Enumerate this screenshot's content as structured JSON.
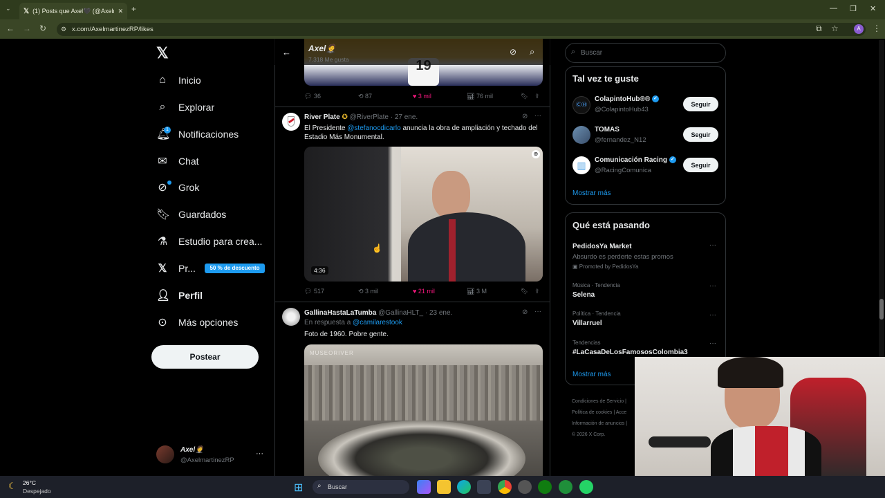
{
  "browser": {
    "tab_title": "(1) Posts que Axel🖤 (@Axelm",
    "url": "x.com/AxelmartinezRP/likes"
  },
  "nav": {
    "items": [
      {
        "label": "Inicio",
        "icon": "home-icon"
      },
      {
        "label": "Explorar",
        "icon": "search-icon"
      },
      {
        "label": "Notificaciones",
        "icon": "bell-icon"
      },
      {
        "label": "Chat",
        "icon": "mail-icon"
      },
      {
        "label": "Grok",
        "icon": "grok-icon"
      },
      {
        "label": "Guardados",
        "icon": "bookmark-icon"
      },
      {
        "label": "Estudio para crea...",
        "icon": "flask-icon"
      },
      {
        "label": "Pr...",
        "icon": "x-logo-icon"
      },
      {
        "label": "Perfil",
        "icon": "person-icon"
      },
      {
        "label": "Más opciones",
        "icon": "more-circle-icon"
      }
    ],
    "notif_count": "1",
    "premium_badge": "50 % de descuento",
    "post_button": "Postear",
    "account_name": "Axel🤵",
    "account_handle": "@AxelmartinezRP"
  },
  "header": {
    "name": "Axel🤵",
    "likes": "7.318 Me gusta"
  },
  "post0": {
    "replies": "36",
    "reposts": "87",
    "likes": "3 mil",
    "views": "76 mil"
  },
  "post1": {
    "name": "River Plate",
    "handle": "@RiverPlate",
    "date": "· 27 ene.",
    "text_a": "El Presidente ",
    "mention": "@stefanocdicarlo",
    "text_b": " anuncia la obra de ampliación y techado del Estadio Más Monumental.",
    "duration": "4:36",
    "replies": "517",
    "reposts": "3 mil",
    "likes": "21 mil",
    "views": "3 M"
  },
  "post2": {
    "name": "GallinaHastaLaTumba",
    "handle": "@GallinaHLT_",
    "date": "· 23 ene.",
    "reply_to_label": "En respuesta a ",
    "reply_to": "@camilarestook",
    "text": "Foto de 1960. Pobre gente.",
    "image_watermark": "MUSEORIVER"
  },
  "right": {
    "search_placeholder": "Buscar",
    "suggest_title": "Tal vez te guste",
    "suggestions": [
      {
        "name": "ColapintoHub®®",
        "handle": "@ColapintoHub43",
        "button": "Seguir"
      },
      {
        "name": "TOMAS",
        "handle": "@fernandez_N12",
        "button": "Seguir"
      },
      {
        "name": "Comunicación Racing",
        "handle": "@RacingComunica",
        "button": "Seguir"
      }
    ],
    "show_more": "Mostrar más",
    "trends_title": "Qué está pasando",
    "trends": [
      {
        "context": "",
        "name": "PedidosYa Market",
        "sub": "Absurdo es perderte estas promos",
        "promo": "Promoted by PedidosYa"
      },
      {
        "context": "Música · Tendencia",
        "name": "Selena"
      },
      {
        "context": "Política · Tendencia",
        "name": "Villarruel"
      },
      {
        "context": "Tendencias",
        "name": "#LaCasaDeLosFamososColombia3"
      }
    ],
    "trends_more": "Mostrar más",
    "footer": [
      "Condiciones de Servicio",
      "|",
      "Política de cookies",
      "|",
      "Acce",
      "Información de anuncios",
      "|",
      "© 2026 X Corp."
    ]
  },
  "taskbar": {
    "weather_temp": "26°C",
    "weather_desc": "Despejado",
    "search": "Buscar"
  }
}
